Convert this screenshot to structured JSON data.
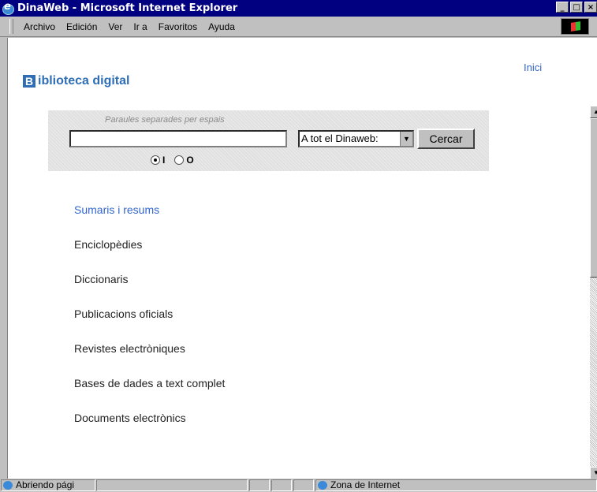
{
  "window": {
    "title": "DinaWeb - Microsoft Internet Explorer",
    "buttons": [
      "_",
      "□",
      "×"
    ]
  },
  "menu": {
    "items": [
      {
        "label": "Archivo"
      },
      {
        "label": "Edición"
      },
      {
        "label": "Ver"
      },
      {
        "label": "Ir a"
      },
      {
        "label": "Favoritos"
      },
      {
        "label": "Ayuda"
      }
    ]
  },
  "page": {
    "inici_link": "Inici",
    "brand_letter": "B",
    "brand_text": "iblioteca digital",
    "search": {
      "hint": "Paraules separades per espais",
      "input_value": "",
      "scope_selected": "A tot el Dinaweb:",
      "button_label": "Cercar",
      "radio_i": "I",
      "radio_o": "O",
      "radio_selected": "I"
    },
    "links": [
      "Sumaris i resums",
      "Enciclopèdies",
      "Diccionaris",
      "Publicacions oficials",
      "Revistes electròniques",
      "Bases de dades a text complet",
      "Documents electrònics"
    ]
  },
  "status": {
    "text": "Abriendo pági",
    "zone": "Zona de Internet"
  },
  "colors": {
    "titlebar": "#000080",
    "link_blue": "#3366cc",
    "brand_blue": "#2f6eb5",
    "chrome": "#c0c0c0"
  }
}
